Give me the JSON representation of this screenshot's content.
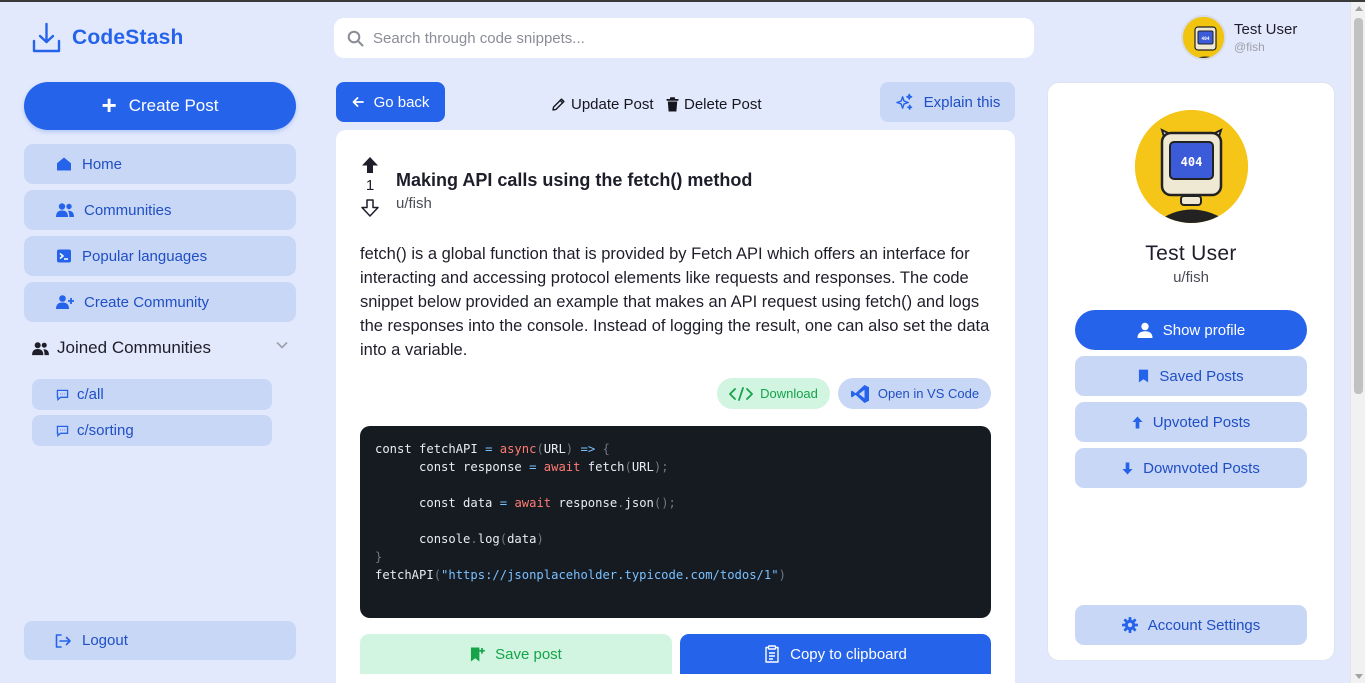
{
  "app": {
    "name": "CodeStash"
  },
  "search": {
    "placeholder": "Search through code snippets..."
  },
  "user": {
    "name": "Test User",
    "handle": "@fish",
    "handle_prefixed": "u/fish",
    "avatar_label": "404"
  },
  "sidebar": {
    "create_post_label": "Create Post",
    "items": [
      {
        "label": "Home",
        "icon": "home-icon"
      },
      {
        "label": "Communities",
        "icon": "users-icon"
      },
      {
        "label": "Popular languages",
        "icon": "terminal-icon"
      },
      {
        "label": "Create Community",
        "icon": "user-plus-icon"
      }
    ],
    "joined_label": "Joined Communities",
    "communities": [
      {
        "label": "c/all"
      },
      {
        "label": "c/sorting"
      }
    ],
    "logout_label": "Logout"
  },
  "toolbar": {
    "go_back_label": "Go back",
    "update_label": "Update Post",
    "delete_label": "Delete Post",
    "explain_label": "Explain this"
  },
  "post": {
    "votes": "1",
    "title": "Making API calls using the fetch() method",
    "author": "u/fish",
    "body": "fetch() is a global function that is provided by Fetch API which offers an interface for interacting and accessing protocol elements like requests and responses. The code snippet below provided an example that makes an API request using fetch() and logs the responses into the console. Instead of logging the result, one can also set the data into a variable.",
    "download_label": "Download",
    "vscode_label": "Open in VS Code",
    "save_label": "Save post",
    "copy_label": "Copy to clipboard",
    "code": {
      "url": "\"https://jsonplaceholder.typicode.com/todos/1\""
    }
  },
  "profile_panel": {
    "show_profile_label": "Show profile",
    "saved_label": "Saved Posts",
    "upvoted_label": "Upvoted Posts",
    "downvoted_label": "Downvoted Posts",
    "settings_label": "Account Settings"
  },
  "colors": {
    "primary": "#2563eb",
    "background": "#e3e9fc",
    "button_light": "#c9d7f7",
    "success": "#16a34a",
    "code_bg": "#161b22"
  }
}
